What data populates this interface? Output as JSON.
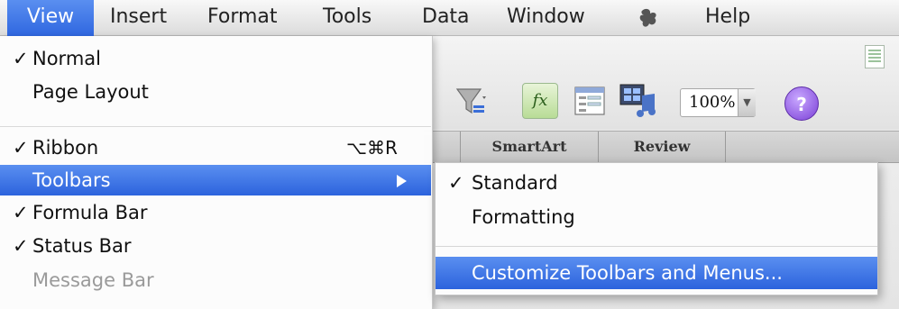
{
  "menubar": {
    "items": [
      "View",
      "Insert",
      "Format",
      "Tools",
      "Data",
      "Window",
      "Help"
    ],
    "active": "View",
    "apple_icon": "scripts-menu-icon"
  },
  "view_menu": {
    "items": [
      {
        "label": "Normal",
        "checked": true
      },
      {
        "label": "Page Layout",
        "checked": false
      },
      {
        "label": "Ribbon",
        "checked": true,
        "shortcut": "⌥⌘R"
      },
      {
        "label": "Toolbars",
        "checked": false,
        "submenu": true,
        "highlighted": true
      },
      {
        "label": "Formula Bar",
        "checked": true
      },
      {
        "label": "Status Bar",
        "checked": true
      },
      {
        "label": "Message Bar",
        "checked": false,
        "disabled": true
      }
    ],
    "check_glyph": "✓"
  },
  "toolbars_submenu": {
    "items": [
      {
        "label": "Standard",
        "checked": true
      },
      {
        "label": "Formatting",
        "checked": false
      },
      {
        "label": "Customize Toolbars and Menus...",
        "highlighted": true
      }
    ]
  },
  "toolbar": {
    "fx_label": "fx",
    "zoom_value": "100%",
    "help_label": "?",
    "icons": [
      "filter-icon",
      "insert-function-icon",
      "form-icon",
      "media-browser-icon",
      "help-icon",
      "new-document-icon"
    ]
  },
  "ribbon": {
    "tabs": [
      "SmartArt",
      "Review"
    ]
  },
  "colors": {
    "highlight": "#2f67e0",
    "menu_background": "#fcfcfc",
    "disabled_text": "#9a9a9a"
  }
}
